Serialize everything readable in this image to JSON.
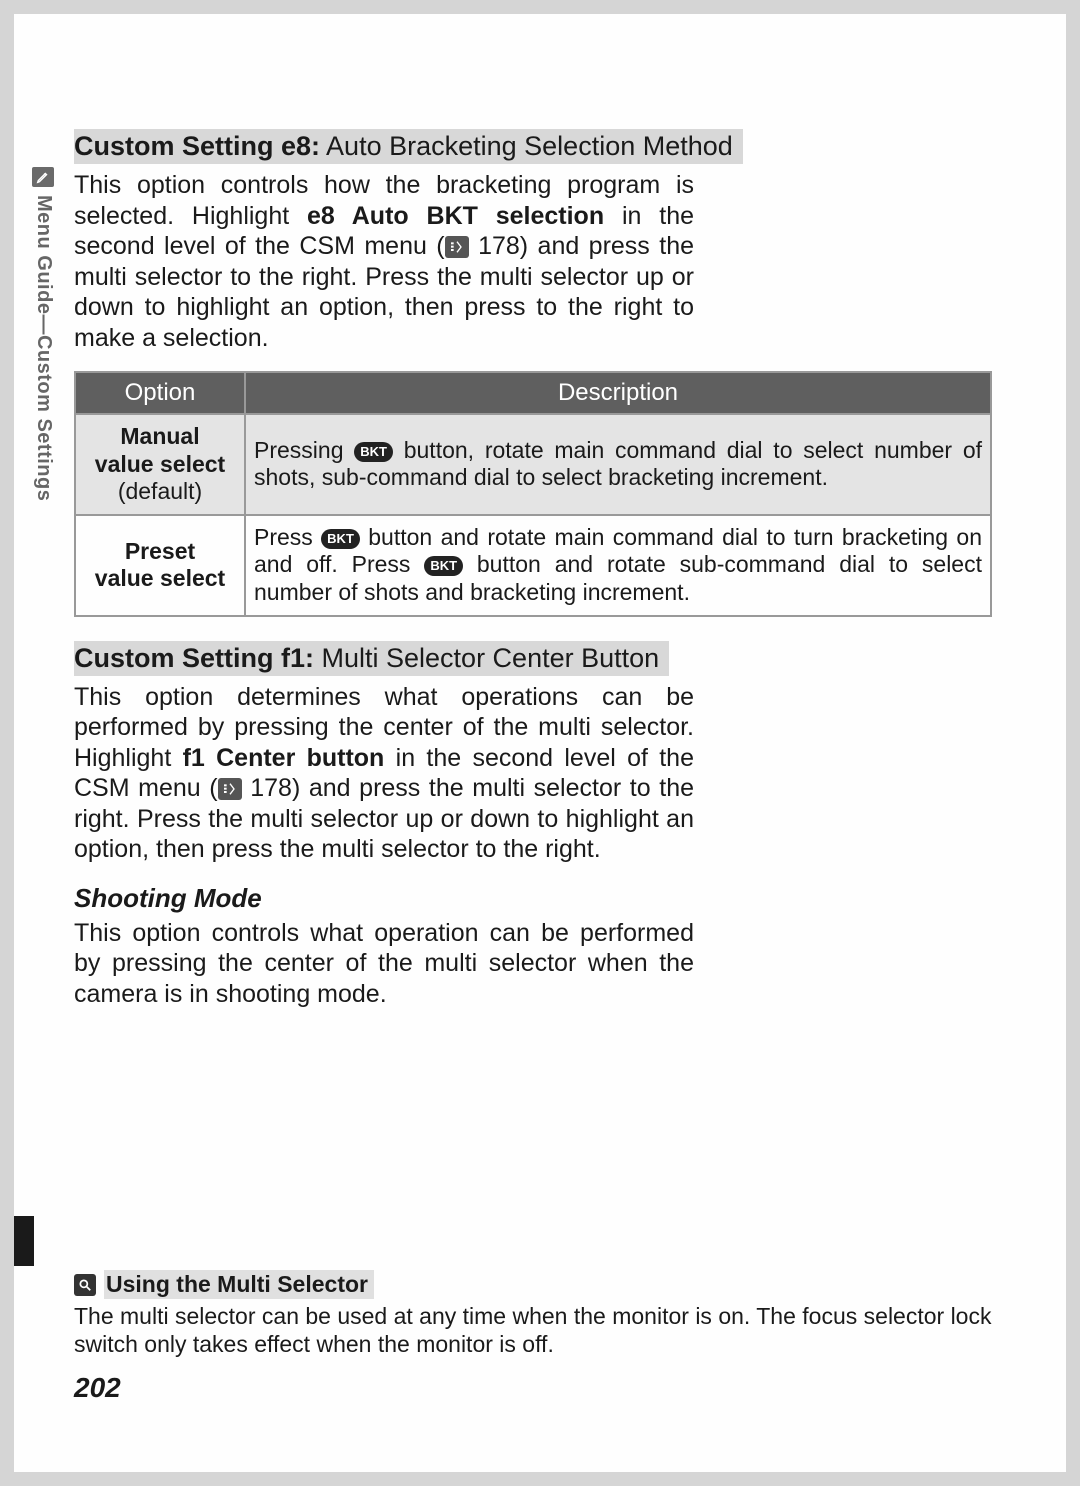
{
  "sidebar": {
    "label": "Menu Guide—Custom Settings"
  },
  "section_e8": {
    "heading_bold": "Custom Setting e8:",
    "heading_rest": " Auto Bracketing Selection Method",
    "para_a": "This option controls how the bracketing program is selected.  Highlight ",
    "para_bold": "e8 Auto BKT selection",
    "para_b": " in the second level of the CSM menu (",
    "page_ref": " 178) and press the multi selector to the right.  Press the multi selector up or down to highlight an option, then press to the right to make a selection."
  },
  "table": {
    "head_option": "Option",
    "head_desc": "Description",
    "rows": [
      {
        "opt_line1": "Manual",
        "opt_line2": "value select",
        "opt_line3": "(default)",
        "desc_a": "Pressing ",
        "desc_b": " button, rotate main command dial to select number of shots, sub-command dial to select bracketing increment."
      },
      {
        "opt_line1": "Preset",
        "opt_line2": "value select",
        "desc_a": "Press ",
        "desc_b": " button and rotate main command dial to turn bracketing on and off.  Press ",
        "desc_c": " button and rotate sub-command dial to select number of shots and bracketing increment."
      }
    ]
  },
  "section_f1": {
    "heading_bold": "Custom Setting f1:",
    "heading_rest": " Multi Selector Center Button",
    "para_a": "This option determines what operations can be performed by pressing the center of the multi selector.  Highlight ",
    "para_bold": "f1 Center button",
    "para_b": " in the second level of the CSM menu (",
    "page_ref": " 178) and press the multi selector to the right.  Press the multi selector up or down to highlight an option, then press the multi selector to the right."
  },
  "shooting": {
    "heading": "Shooting Mode",
    "para": "This option controls what operation can be performed by pressing the center of the multi selector when the camera is in shooting mode."
  },
  "footer": {
    "tip_title": "Using the Multi Selector",
    "tip_body": "The multi selector can be used at any time when the monitor is on.  The focus selector lock switch only takes effect when the monitor is off."
  },
  "icons": {
    "bkt_label": "BKT"
  },
  "page_number": "202"
}
